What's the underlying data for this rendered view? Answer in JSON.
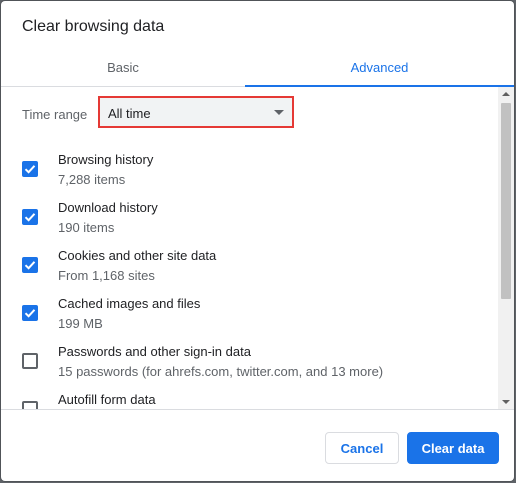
{
  "dialog": {
    "title": "Clear browsing data"
  },
  "tabs": [
    {
      "label": "Basic",
      "active": false
    },
    {
      "label": "Advanced",
      "active": true
    }
  ],
  "time_range": {
    "label": "Time range",
    "value": "All time"
  },
  "items": [
    {
      "title": "Browsing history",
      "subtitle": "7,288 items",
      "checked": true
    },
    {
      "title": "Download history",
      "subtitle": "190 items",
      "checked": true
    },
    {
      "title": "Cookies and other site data",
      "subtitle": "From 1,168 sites",
      "checked": true
    },
    {
      "title": "Cached images and files",
      "subtitle": "199 MB",
      "checked": true
    },
    {
      "title": "Passwords and other sign-in data",
      "subtitle": "15 passwords (for ahrefs.com, twitter.com, and 13 more)",
      "checked": false
    },
    {
      "title": "Autofill form data",
      "subtitle": "",
      "checked": false
    }
  ],
  "buttons": {
    "cancel": "Cancel",
    "clear": "Clear data"
  },
  "colors": {
    "accent": "#1a73e8",
    "highlight_border": "#e53935"
  }
}
